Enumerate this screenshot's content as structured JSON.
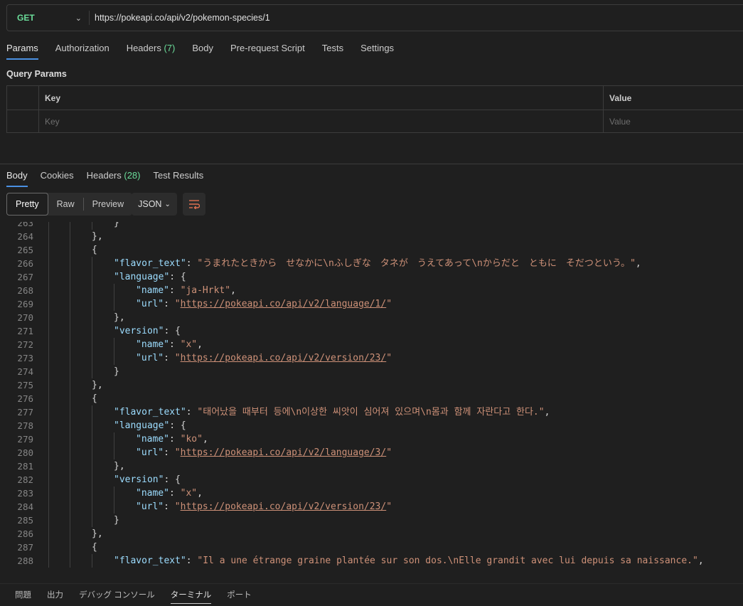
{
  "request": {
    "method": "GET",
    "url": "https://pokeapi.co/api/v2/pokemon-species/1"
  },
  "request_tabs": [
    {
      "label": "Params",
      "count": ""
    },
    {
      "label": "Authorization",
      "count": ""
    },
    {
      "label": "Headers ",
      "count": "(7)"
    },
    {
      "label": "Body",
      "count": ""
    },
    {
      "label": "Pre-request Script",
      "count": ""
    },
    {
      "label": "Tests",
      "count": ""
    },
    {
      "label": "Settings",
      "count": ""
    }
  ],
  "query_params": {
    "title": "Query Params",
    "key_header": "Key",
    "value_header": "Value",
    "key_placeholder": "Key",
    "value_placeholder": "Value"
  },
  "response_tabs": [
    {
      "label": "Body",
      "count": ""
    },
    {
      "label": "Cookies",
      "count": ""
    },
    {
      "label": "Headers ",
      "count": "(28)"
    },
    {
      "label": "Test Results",
      "count": ""
    }
  ],
  "view_modes": [
    "Pretty",
    "Raw",
    "Preview"
  ],
  "format": "JSON",
  "colors": {
    "key": "#9cdcfe",
    "string": "#ce9178",
    "method": "#6bdd9a",
    "tab_underline": "#4a90e2"
  },
  "code_lines": [
    {
      "n": "263",
      "indent": 2,
      "t": [
        [
          "p",
          "}"
        ]
      ]
    },
    {
      "n": "264",
      "indent": 1,
      "t": [
        [
          "p",
          "},"
        ]
      ]
    },
    {
      "n": "265",
      "indent": 1,
      "t": [
        [
          "p",
          "{"
        ]
      ]
    },
    {
      "n": "266",
      "indent": 2,
      "t": [
        [
          "k",
          "\"flavor_text\""
        ],
        [
          "p",
          ": "
        ],
        [
          "s",
          "\"うまれたときから　せなかに\\nふしぎな　タネが　うえてあって\\nからだと　ともに　そだつという。\""
        ],
        [
          "p",
          ","
        ]
      ]
    },
    {
      "n": "267",
      "indent": 2,
      "t": [
        [
          "k",
          "\"language\""
        ],
        [
          "p",
          ": {"
        ]
      ]
    },
    {
      "n": "268",
      "indent": 3,
      "t": [
        [
          "k",
          "\"name\""
        ],
        [
          "p",
          ": "
        ],
        [
          "s",
          "\"ja-Hrkt\""
        ],
        [
          "p",
          ","
        ]
      ]
    },
    {
      "n": "269",
      "indent": 3,
      "t": [
        [
          "k",
          "\"url\""
        ],
        [
          "p",
          ": "
        ],
        [
          "s",
          "\""
        ],
        [
          "u",
          "https://pokeapi.co/api/v2/language/1/"
        ],
        [
          "s",
          "\""
        ]
      ]
    },
    {
      "n": "270",
      "indent": 2,
      "t": [
        [
          "p",
          "},"
        ]
      ]
    },
    {
      "n": "271",
      "indent": 2,
      "t": [
        [
          "k",
          "\"version\""
        ],
        [
          "p",
          ": {"
        ]
      ]
    },
    {
      "n": "272",
      "indent": 3,
      "t": [
        [
          "k",
          "\"name\""
        ],
        [
          "p",
          ": "
        ],
        [
          "s",
          "\"x\""
        ],
        [
          "p",
          ","
        ]
      ]
    },
    {
      "n": "273",
      "indent": 3,
      "t": [
        [
          "k",
          "\"url\""
        ],
        [
          "p",
          ": "
        ],
        [
          "s",
          "\""
        ],
        [
          "u",
          "https://pokeapi.co/api/v2/version/23/"
        ],
        [
          "s",
          "\""
        ]
      ]
    },
    {
      "n": "274",
      "indent": 2,
      "t": [
        [
          "p",
          "}"
        ]
      ]
    },
    {
      "n": "275",
      "indent": 1,
      "t": [
        [
          "p",
          "},"
        ]
      ]
    },
    {
      "n": "276",
      "indent": 1,
      "t": [
        [
          "p",
          "{"
        ]
      ]
    },
    {
      "n": "277",
      "indent": 2,
      "t": [
        [
          "k",
          "\"flavor_text\""
        ],
        [
          "p",
          ": "
        ],
        [
          "s",
          "\"태어났을 때부터 등에\\n이상한 씨앗이 심어져 있으며\\n몸과 함께 자란다고 한다.\""
        ],
        [
          "p",
          ","
        ]
      ]
    },
    {
      "n": "278",
      "indent": 2,
      "t": [
        [
          "k",
          "\"language\""
        ],
        [
          "p",
          ": {"
        ]
      ]
    },
    {
      "n": "279",
      "indent": 3,
      "t": [
        [
          "k",
          "\"name\""
        ],
        [
          "p",
          ": "
        ],
        [
          "s",
          "\"ko\""
        ],
        [
          "p",
          ","
        ]
      ]
    },
    {
      "n": "280",
      "indent": 3,
      "t": [
        [
          "k",
          "\"url\""
        ],
        [
          "p",
          ": "
        ],
        [
          "s",
          "\""
        ],
        [
          "u",
          "https://pokeapi.co/api/v2/language/3/"
        ],
        [
          "s",
          "\""
        ]
      ]
    },
    {
      "n": "281",
      "indent": 2,
      "t": [
        [
          "p",
          "},"
        ]
      ]
    },
    {
      "n": "282",
      "indent": 2,
      "t": [
        [
          "k",
          "\"version\""
        ],
        [
          "p",
          ": {"
        ]
      ]
    },
    {
      "n": "283",
      "indent": 3,
      "t": [
        [
          "k",
          "\"name\""
        ],
        [
          "p",
          ": "
        ],
        [
          "s",
          "\"x\""
        ],
        [
          "p",
          ","
        ]
      ]
    },
    {
      "n": "284",
      "indent": 3,
      "t": [
        [
          "k",
          "\"url\""
        ],
        [
          "p",
          ": "
        ],
        [
          "s",
          "\""
        ],
        [
          "u",
          "https://pokeapi.co/api/v2/version/23/"
        ],
        [
          "s",
          "\""
        ]
      ]
    },
    {
      "n": "285",
      "indent": 2,
      "t": [
        [
          "p",
          "}"
        ]
      ]
    },
    {
      "n": "286",
      "indent": 1,
      "t": [
        [
          "p",
          "},"
        ]
      ]
    },
    {
      "n": "287",
      "indent": 1,
      "t": [
        [
          "p",
          "{"
        ]
      ]
    },
    {
      "n": "288",
      "indent": 2,
      "t": [
        [
          "k",
          "\"flavor_text\""
        ],
        [
          "p",
          ": "
        ],
        [
          "s",
          "\"Il a une étrange graine plantée sur son dos.\\nElle grandit avec lui depuis sa naissance.\""
        ],
        [
          "p",
          ","
        ]
      ]
    }
  ],
  "status_bar": [
    "問題",
    "出力",
    "デバッグ コンソール",
    "ターミナル",
    "ポート"
  ],
  "status_bar_active": 3
}
